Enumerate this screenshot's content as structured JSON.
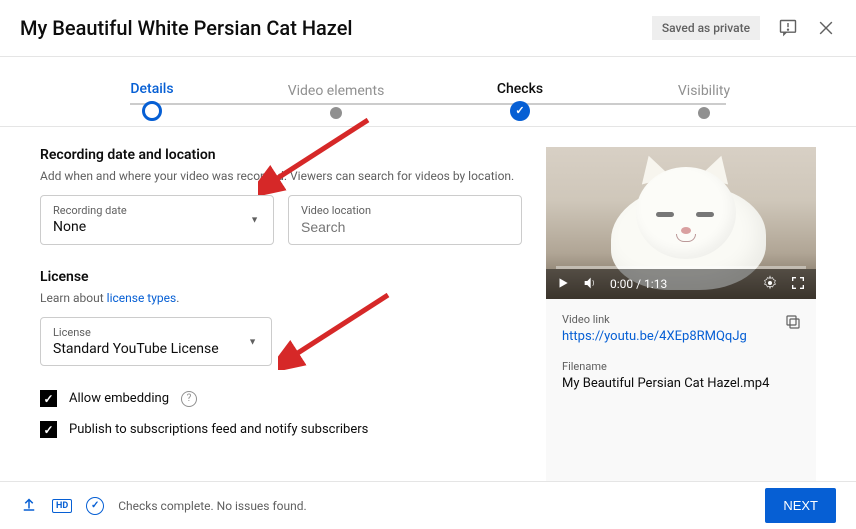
{
  "header": {
    "title": "My Beautiful White Persian Cat Hazel",
    "saved_badge": "Saved as private"
  },
  "stepper": {
    "steps": [
      {
        "label": "Details",
        "state": "active"
      },
      {
        "label": "Video elements",
        "state": ""
      },
      {
        "label": "Checks",
        "state": "done"
      },
      {
        "label": "Visibility",
        "state": ""
      }
    ]
  },
  "recording": {
    "title": "Recording date and location",
    "desc": "Add when and where your video was recorded. Viewers can search for videos by location.",
    "date_label": "Recording date",
    "date_value": "None",
    "location_label": "Video location",
    "location_placeholder": "Search"
  },
  "license": {
    "title": "License",
    "learn_prefix": "Learn about ",
    "learn_link": "license types",
    "learn_suffix": ".",
    "field_label": "License",
    "field_value": "Standard YouTube License"
  },
  "checkboxes": {
    "embed": "Allow embedding",
    "publish": "Publish to subscriptions feed and notify subscribers"
  },
  "preview": {
    "time": "0:00 / 1:13",
    "link_label": "Video link",
    "link": "https://youtu.be/4XEp8RMQqJg",
    "file_label": "Filename",
    "file": "My Beautiful Persian Cat Hazel.mp4"
  },
  "footer": {
    "status": "Checks complete. No issues found.",
    "next": "NEXT",
    "hd": "HD"
  }
}
